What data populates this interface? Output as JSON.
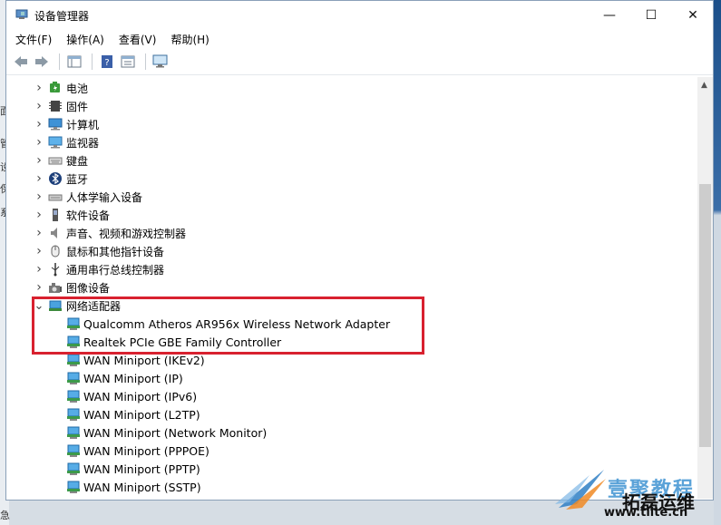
{
  "window": {
    "title": "设备管理器",
    "minimize": "—",
    "maximize": "☐",
    "close": "✕"
  },
  "menu": [
    "文件(F)",
    "操作(A)",
    "查看(V)",
    "帮助(H)"
  ],
  "tree": {
    "categories": [
      {
        "label": "电池",
        "icon": "battery-icon",
        "expanded": false
      },
      {
        "label": "固件",
        "icon": "firmware-icon",
        "expanded": false
      },
      {
        "label": "计算机",
        "icon": "computer-icon",
        "expanded": false
      },
      {
        "label": "监视器",
        "icon": "monitor-icon",
        "expanded": false
      },
      {
        "label": "键盘",
        "icon": "keyboard-icon",
        "expanded": false
      },
      {
        "label": "蓝牙",
        "icon": "bluetooth-icon",
        "expanded": false
      },
      {
        "label": "人体学输入设备",
        "icon": "hid-icon",
        "expanded": false
      },
      {
        "label": "软件设备",
        "icon": "software-device-icon",
        "expanded": false
      },
      {
        "label": "声音、视频和游戏控制器",
        "icon": "speaker-icon",
        "expanded": false
      },
      {
        "label": "鼠标和其他指针设备",
        "icon": "mouse-icon",
        "expanded": false
      },
      {
        "label": "通用串行总线控制器",
        "icon": "usb-icon",
        "expanded": false
      },
      {
        "label": "图像设备",
        "icon": "camera-icon",
        "expanded": false
      },
      {
        "label": "网络适配器",
        "icon": "network-adapter-icon",
        "expanded": true
      }
    ],
    "network_adapters": [
      "Qualcomm Atheros AR956x Wireless Network Adapter",
      "Realtek PCIe GBE Family Controller",
      "WAN Miniport (IKEv2)",
      "WAN Miniport (IP)",
      "WAN Miniport (IPv6)",
      "WAN Miniport (L2TP)",
      "WAN Miniport (Network Monitor)",
      "WAN Miniport (PPPOE)",
      "WAN Miniport (PPTP)",
      "WAN Miniport (SSTP)"
    ]
  },
  "highlight_color": "#d8212f",
  "watermark": {
    "line1": "壹聚教程",
    "line2": "拓磊运维",
    "line3": "www.tllte.cn"
  },
  "desktop_glyphs": [
    "面",
    "管",
    "设",
    "保",
    "系",
    "急"
  ]
}
